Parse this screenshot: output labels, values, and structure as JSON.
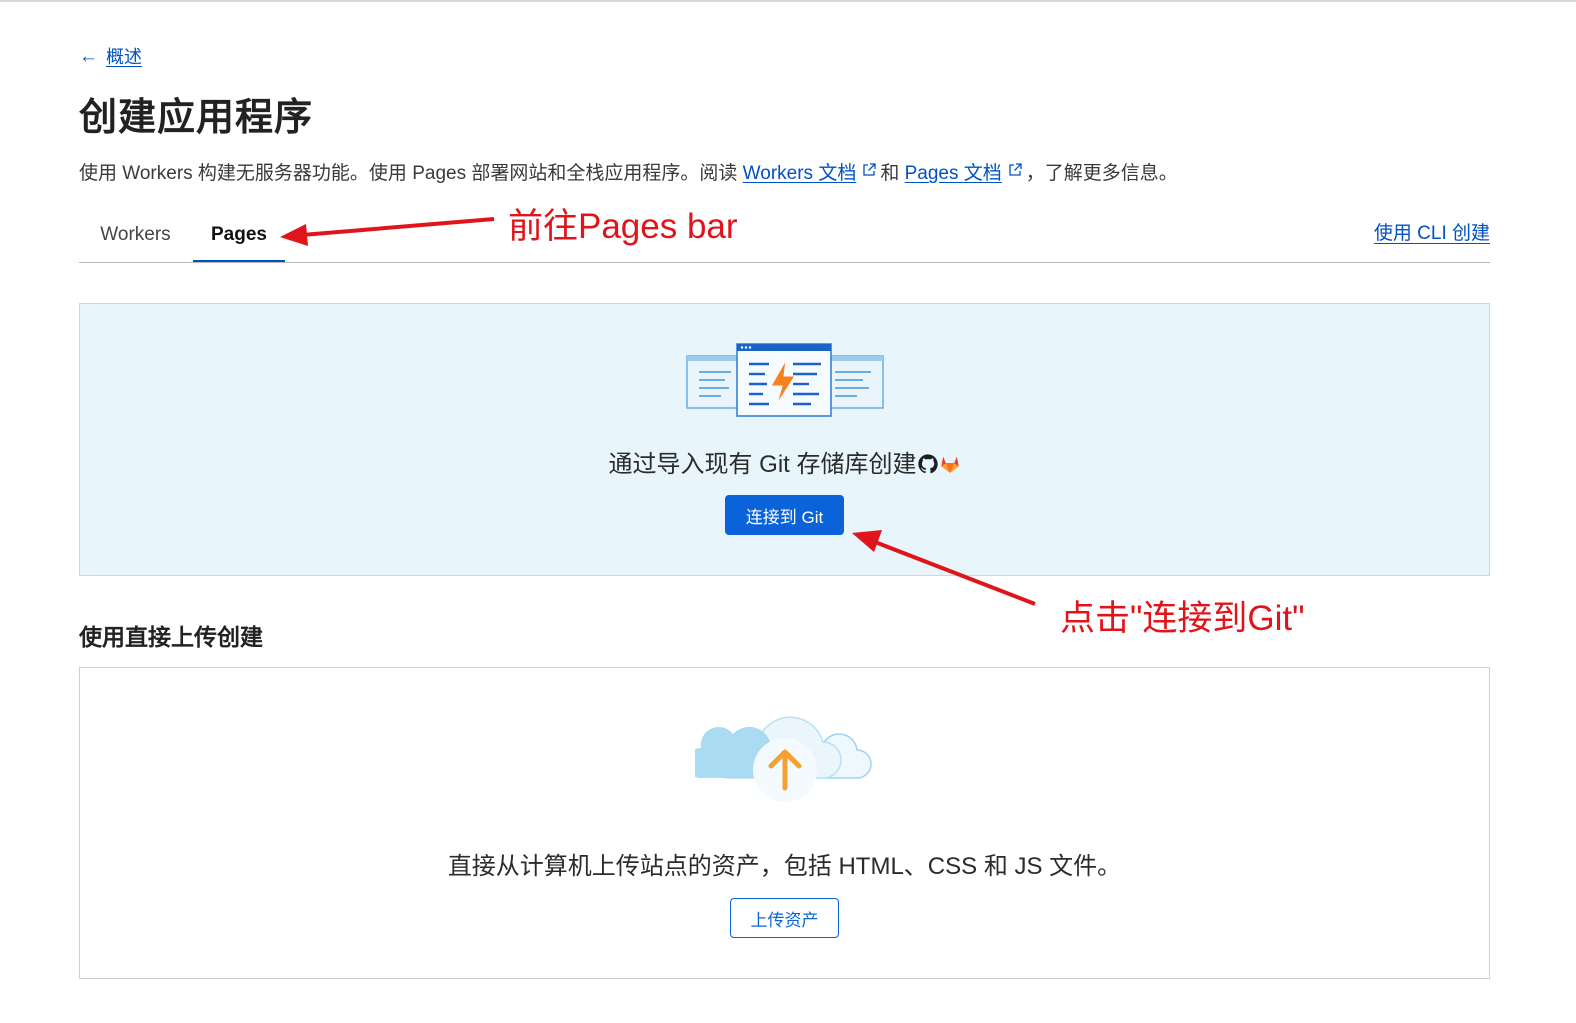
{
  "nav": {
    "back_label": "概述"
  },
  "page": {
    "title": "创建应用程序",
    "description": {
      "lead": "使用 Workers 构建无服务器功能。使用 Pages 部署网站和全栈应用程序。阅读 ",
      "workers_docs_link": "Workers 文档",
      "and": "和",
      "pages_docs_link": "Pages 文档",
      "tail": "，了解更多信息。"
    }
  },
  "tabs": [
    {
      "label": "Workers",
      "active": false
    },
    {
      "label": "Pages",
      "active": true
    }
  ],
  "cli_link": "使用 CLI 创建",
  "git_section": {
    "text": "通过导入现有 Git 存储库创建",
    "button_label": "连接到 Git"
  },
  "direct_upload": {
    "heading": "使用直接上传创建",
    "text": "直接从计算机上传站点的资产，包括 HTML、CSS 和 JS 文件。",
    "button_label": "上传资产"
  },
  "annotations": {
    "pages_tab_note": "前往Pages bar",
    "connect_git_note": "点击\"连接到Git\""
  },
  "icons": [
    "back-arrow-icon",
    "external-link-icon",
    "github-icon",
    "gitlab-icon",
    "upload-arrow-icon"
  ],
  "colors": {
    "link": "#0051c3",
    "primary_button": "#0a63d8",
    "git_panel_bg": "#e8f5fb",
    "annotation_red": "#e0141b",
    "upload_arrow": "#f6a033"
  }
}
